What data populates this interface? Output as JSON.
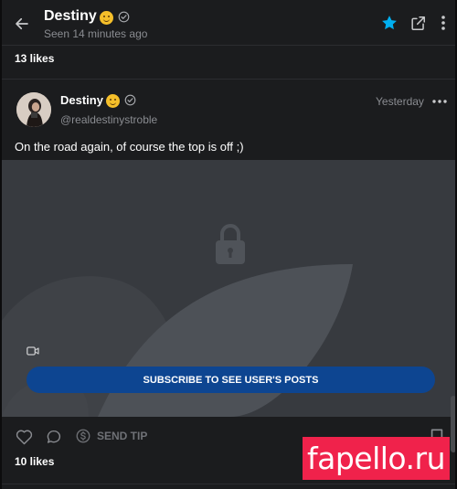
{
  "header": {
    "name": "Destiny",
    "status": "Seen 14 minutes ago",
    "back_icon": "arrow-left-icon",
    "favorite_icon": "star-icon",
    "share_icon": "share-icon",
    "more_icon": "kebab-menu-icon"
  },
  "previous_post": {
    "likes": "13 likes"
  },
  "post": {
    "author_name": "Destiny",
    "handle": "@realdestinystroble",
    "time": "Yesterday",
    "text": "On the road again, of course the top is off ;)",
    "media": {
      "locked": true,
      "media_type_icon": "video-icon",
      "subscribe_label": "SUBSCRIBE TO SEE USER'S POSTS"
    },
    "actions": {
      "like_icon": "heart-icon",
      "comment_icon": "comment-icon",
      "tip_icon": "dollar-icon",
      "tip_label": "SEND TIP",
      "bookmark_icon": "bookmark-icon"
    },
    "likes": "10 likes"
  },
  "watermark": {
    "text": "fapello.ru"
  },
  "colors": {
    "background": "#1b1c1e",
    "accent": "#00aff0",
    "subscribe_button": "#0d4591",
    "muted_text": "#8a8c91",
    "watermark_bg": "#f0224b"
  }
}
